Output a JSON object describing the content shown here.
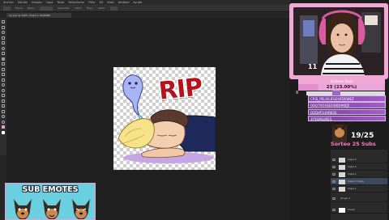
{
  "app": {
    "menu": [
      "Archivo",
      "Edición",
      "Imagen",
      "Capa",
      "Texto",
      "Seleccionar",
      "Filtro",
      "3D",
      "Vista",
      "Ventana",
      "Ayuda"
    ],
    "options": [
      "Pincel",
      "Modo:",
      "Normal",
      "Opacidad:",
      "100%",
      "Flujo:",
      "100%"
    ],
    "document_tab": "rip.psd @ 100% (Capa 1, RGB/8#)"
  },
  "canvas": {
    "rip_text": "RIP"
  },
  "sub_emotes": {
    "title": "SUB EMOTES"
  },
  "webcam": {
    "viewer_count": "11"
  },
  "follower_goal": {
    "label": "Follower Goal",
    "value_text": "23 (23.00%)",
    "progress_fraction": 0.23,
    "zero_label": "0"
  },
  "queue_rows": [
    "CRIS_PELIVLIFH2HFDSWEZ",
    "DBQ7ROSSESSNDHKKJ5",
    "DODATLUHRESS",
    "3YSSMLUKES"
  ],
  "giveaway": {
    "counter": "19/25",
    "title": "Sorteo 25 Subs"
  },
  "layers": [
    "Capa 4",
    "Capa 3",
    "Capa 2",
    "Capa 1 copia",
    "Capa 1",
    "Grupo 1",
    "Fondo"
  ],
  "colors": {
    "accent_pink": "#f2a8d4",
    "goal_bar": "#e48fd0",
    "rip_red": "#b5121b",
    "banner_blue": "#6ad0e0",
    "queue_purple": "#7b3fa0"
  }
}
